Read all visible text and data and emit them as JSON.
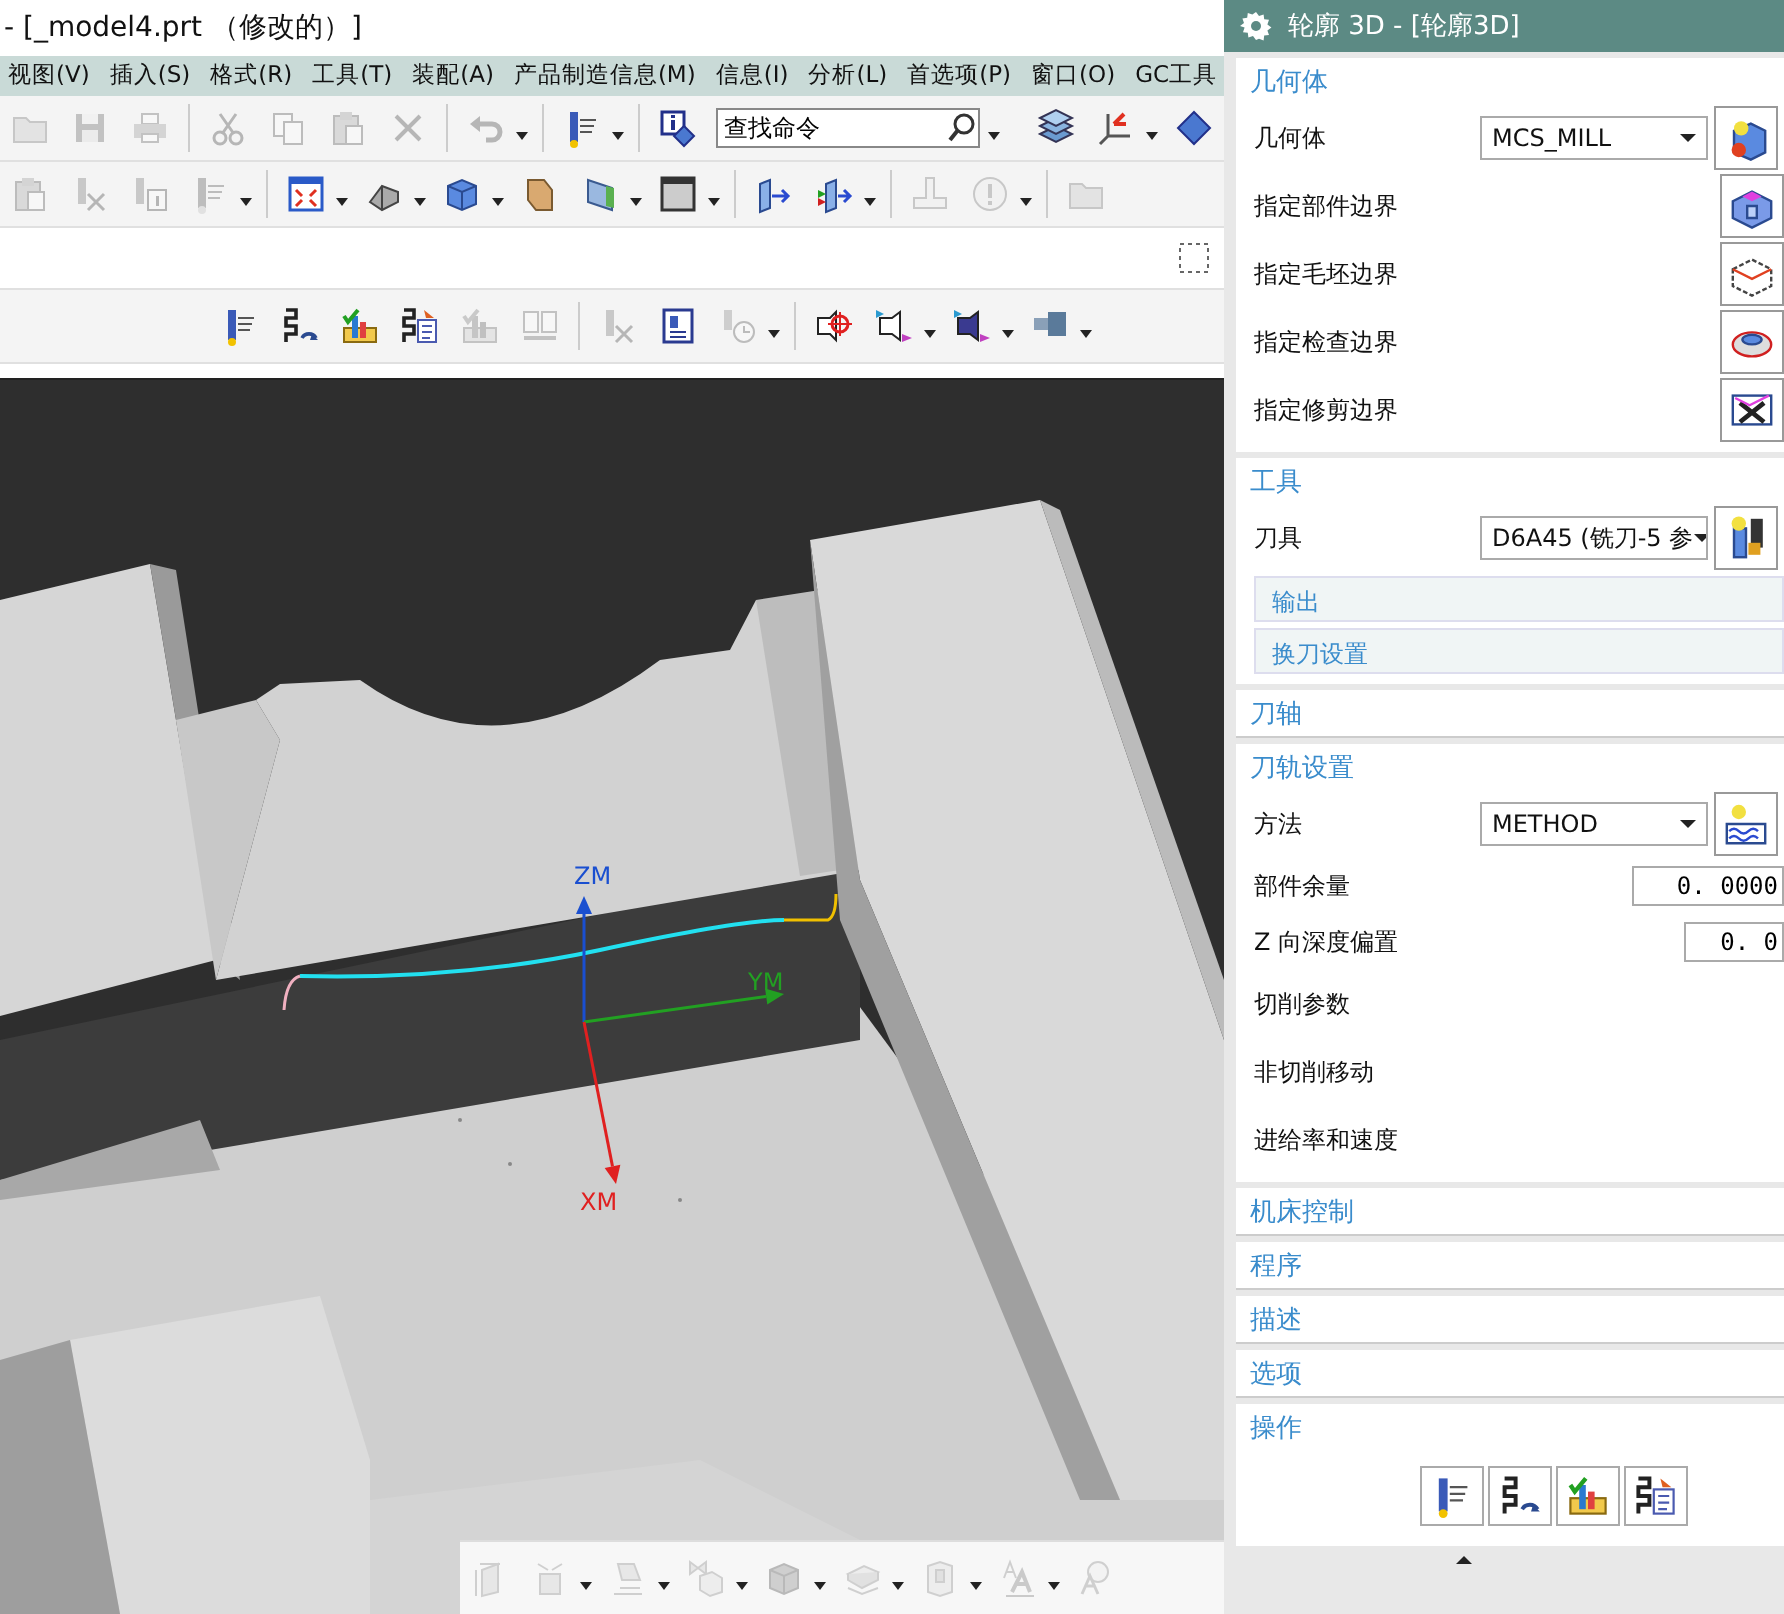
{
  "window": {
    "title": "- [_model4.prt （修改的）]"
  },
  "menu": [
    "视图(V)",
    "插入(S)",
    "格式(R)",
    "工具(T)",
    "装配(A)",
    "产品制造信息(M)",
    "信息(I)",
    "分析(L)",
    "首选项(P)",
    "窗口(O)",
    "GC工具"
  ],
  "toolbars": [
    {
      "items": [
        {
          "kind": "folder",
          "disabled": true,
          "dropdown": false
        },
        {
          "kind": "floppy",
          "disabled": true,
          "dropdown": false
        },
        {
          "kind": "printer",
          "disabled": true,
          "dropdown": false
        },
        {
          "kind": "sep"
        },
        {
          "kind": "scissors",
          "disabled": true,
          "dropdown": false
        },
        {
          "kind": "copy",
          "disabled": true,
          "dropdown": false
        },
        {
          "kind": "paste",
          "disabled": true,
          "dropdown": false
        },
        {
          "kind": "cross",
          "disabled": true,
          "dropdown": false
        },
        {
          "kind": "sep"
        },
        {
          "kind": "undo",
          "disabled": true,
          "dropdown": true
        },
        {
          "kind": "sep"
        },
        {
          "kind": "mill",
          "disabled": false,
          "dropdown": true
        },
        {
          "kind": "sep"
        },
        {
          "kind": "info",
          "disabled": false,
          "dropdown": false
        },
        {
          "kind": "search"
        },
        {
          "kind": "gap"
        },
        {
          "kind": "layers",
          "disabled": false,
          "dropdown": false
        },
        {
          "kind": "csys",
          "disabled": false,
          "dropdown": true
        },
        {
          "kind": "diamond",
          "disabled": false,
          "dropdown": false
        }
      ]
    },
    {
      "items": [
        {
          "kind": "paste",
          "disabled": true,
          "dropdown": false
        },
        {
          "kind": "millx",
          "disabled": true,
          "dropdown": false
        },
        {
          "kind": "millinfo",
          "disabled": true,
          "dropdown": false
        },
        {
          "kind": "mill",
          "disabled": true,
          "dropdown": true
        },
        {
          "kind": "sep"
        },
        {
          "kind": "fit",
          "disabled": false,
          "dropdown": true
        },
        {
          "kind": "bracket",
          "disabled": false,
          "dropdown": true
        },
        {
          "kind": "cube",
          "disabled": false,
          "dropdown": true
        },
        {
          "kind": "plane",
          "disabled": false,
          "dropdown": false
        },
        {
          "kind": "planeg",
          "disabled": false,
          "dropdown": true
        },
        {
          "kind": "window",
          "disabled": false,
          "dropdown": true
        },
        {
          "kind": "sep"
        },
        {
          "kind": "boxarrow",
          "disabled": false,
          "dropdown": false
        },
        {
          "kind": "boxarrow2",
          "disabled": false,
          "dropdown": true
        },
        {
          "kind": "sep"
        },
        {
          "kind": "stand",
          "disabled": true,
          "dropdown": false
        },
        {
          "kind": "warning",
          "disabled": true,
          "dropdown": true
        },
        {
          "kind": "sep"
        },
        {
          "kind": "folder",
          "disabled": true,
          "dropdown": false
        }
      ]
    },
    {
      "items": [
        {
          "kind": "gap"
        },
        {
          "kind": "grid",
          "disabled": false,
          "dropdown": false
        }
      ]
    },
    {
      "items": [
        {
          "kind": "indent"
        },
        {
          "kind": "mill",
          "disabled": false,
          "dropdown": false
        },
        {
          "kind": "path",
          "disabled": false,
          "dropdown": false
        },
        {
          "kind": "verify",
          "disabled": false,
          "dropdown": false
        },
        {
          "kind": "list",
          "disabled": false,
          "dropdown": false
        },
        {
          "kind": "verify",
          "disabled": true,
          "dropdown": false
        },
        {
          "kind": "doc2",
          "disabled": true,
          "dropdown": false
        },
        {
          "kind": "sep"
        },
        {
          "kind": "millx",
          "disabled": true,
          "dropdown": false
        },
        {
          "kind": "doc",
          "disabled": false,
          "dropdown": false
        },
        {
          "kind": "clock",
          "disabled": true,
          "dropdown": true
        },
        {
          "kind": "sep"
        },
        {
          "kind": "target",
          "disabled": false,
          "dropdown": false
        },
        {
          "kind": "profile",
          "disabled": false,
          "dropdown": true
        },
        {
          "kind": "profileb",
          "disabled": false,
          "dropdown": true
        },
        {
          "kind": "cylinder",
          "disabled": false,
          "dropdown": true
        }
      ]
    }
  ],
  "search": {
    "placeholder": "查找命令"
  },
  "viewport": {
    "axes": [
      {
        "label": "ZM",
        "color": "#1a4fd0"
      },
      {
        "label": "YM",
        "color": "#22a022"
      },
      {
        "label": "XM",
        "color": "#e02020"
      }
    ]
  },
  "bottom_toolbar": {
    "items": [
      {
        "kind": "dimension",
        "disabled": true,
        "dropdown": false
      },
      {
        "kind": "box",
        "disabled": true,
        "dropdown": true
      },
      {
        "kind": "surface",
        "disabled": true,
        "dropdown": true
      },
      {
        "kind": "valve",
        "disabled": true,
        "dropdown": true
      },
      {
        "kind": "cube",
        "disabled": true,
        "dropdown": true
      },
      {
        "kind": "stack",
        "disabled": true,
        "dropdown": true
      },
      {
        "kind": "shell",
        "disabled": true,
        "dropdown": true
      },
      {
        "kind": "textstyle",
        "disabled": true,
        "dropdown": true
      },
      {
        "kind": "magnifier",
        "disabled": true,
        "dropdown": false
      }
    ]
  },
  "dialog": {
    "title": "轮廓 3D - [轮廓3D]",
    "sections": [
      {
        "title": "几何体",
        "expanded": true,
        "rows": [
          {
            "kind": "select",
            "label": "几何体",
            "value": "MCS_MILL"
          },
          {
            "kind": "button",
            "label": "指定部件边界"
          },
          {
            "kind": "button",
            "label": "指定毛坯边界"
          },
          {
            "kind": "button",
            "label": "指定检查边界"
          },
          {
            "kind": "button",
            "label": "指定修剪边界"
          }
        ]
      },
      {
        "title": "工具",
        "expanded": true,
        "rows": [
          {
            "kind": "select",
            "label": "刀具",
            "value": "D6A45 (铣刀-5 参"
          },
          {
            "kind": "subgroup",
            "label": "输出"
          },
          {
            "kind": "subgroup",
            "label": "换刀设置"
          }
        ]
      },
      {
        "title": "刀轴",
        "expanded": false
      },
      {
        "title": "刀轨设置",
        "expanded": true,
        "rows": [
          {
            "kind": "select",
            "label": "方法",
            "value": "METHOD"
          },
          {
            "kind": "number",
            "label": "部件余量",
            "value": "0. 0000"
          },
          {
            "kind": "number",
            "label": "Z 向深度偏置",
            "value": "0. 0"
          },
          {
            "kind": "label",
            "label": "切削参数"
          },
          {
            "kind": "label",
            "label": "非切削移动"
          },
          {
            "kind": "label",
            "label": "进给率和速度"
          }
        ]
      },
      {
        "title": "机床控制",
        "expanded": false
      },
      {
        "title": "程序",
        "expanded": false
      },
      {
        "title": "描述",
        "expanded": false
      },
      {
        "title": "选项",
        "expanded": false
      },
      {
        "title": "操作",
        "expanded": true,
        "rows": [
          {
            "kind": "actions"
          }
        ]
      }
    ]
  }
}
